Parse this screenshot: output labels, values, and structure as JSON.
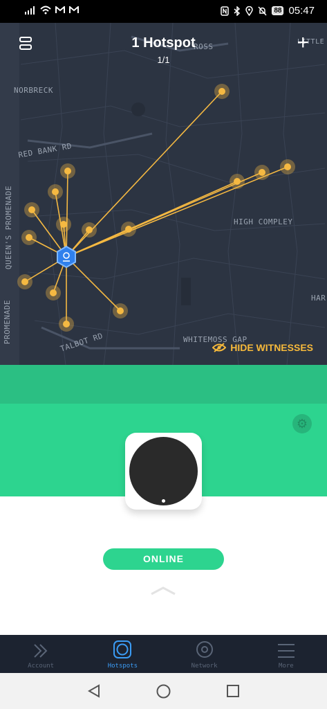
{
  "status_bar": {
    "time": "05:47",
    "battery": "88",
    "left_icons": [
      "signal-icon",
      "wifi-icon",
      "gmail-icon",
      "gmail-icon"
    ],
    "right_icons": [
      "nfc-icon",
      "bluetooth-icon",
      "location-icon",
      "mute-icon",
      "battery-icon"
    ]
  },
  "header": {
    "title": "1 Hotspot",
    "subtitle": "1/1",
    "menu_icon": "list-icon",
    "add_icon": "plus-icon"
  },
  "map": {
    "labels": [
      "NORBRECK",
      "RED BANK RD",
      "HIGH COMPLEY",
      "WHITEMOSS GAP",
      "TALBOT RD",
      "QUEEN'S PROMENADE",
      "PROMENADE",
      "LITTLE",
      "ROSS",
      "HAR"
    ],
    "hide_witnesses_label": "HIDE WITNESSES",
    "line_color": "#f5b942",
    "hotspot_color": "#2f80ed"
  },
  "device": {
    "status": "ONLINE",
    "accent": "#2dd48f"
  },
  "bottom_nav": [
    {
      "label": "Account",
      "icon": "chevron-double-right-icon",
      "active": false
    },
    {
      "label": "Hotspots",
      "icon": "hotspot-square-icon",
      "active": true
    },
    {
      "label": "Network",
      "icon": "target-icon",
      "active": false
    },
    {
      "label": "More",
      "icon": "menu-icon",
      "active": false
    }
  ]
}
